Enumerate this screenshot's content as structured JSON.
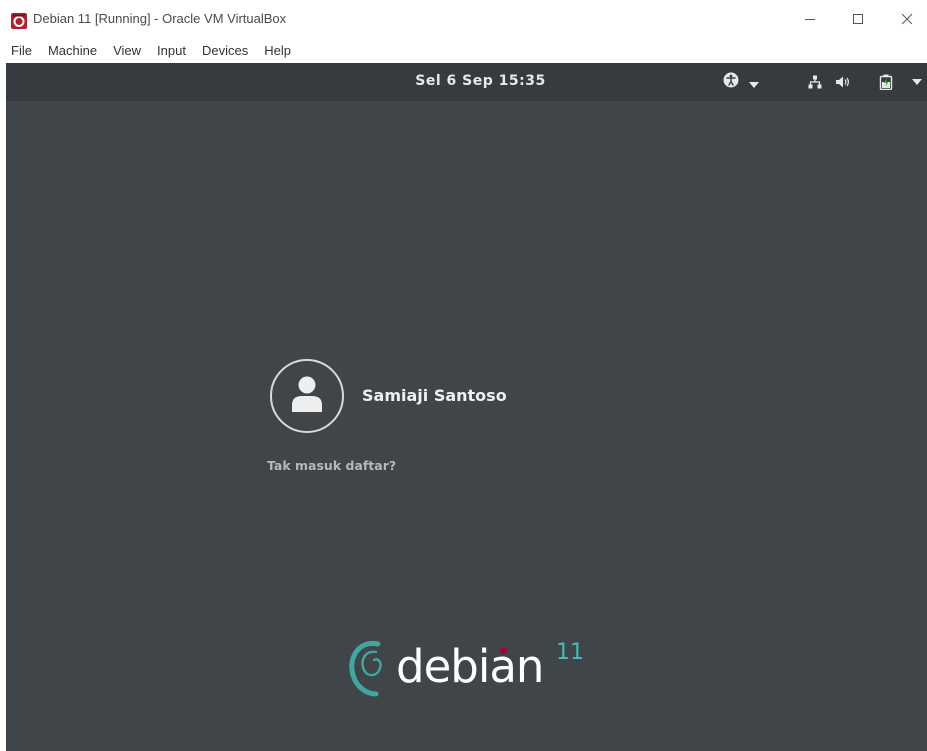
{
  "window": {
    "title": "Debian 11 [Running] - Oracle VM VirtualBox",
    "icon": "virtualbox-icon",
    "controls": [
      "minimize-icon",
      "maximize-icon",
      "close-icon"
    ]
  },
  "menubar": {
    "items": [
      "File",
      "Machine",
      "View",
      "Input",
      "Devices",
      "Help"
    ]
  },
  "gnome_topbar": {
    "clock": "Sel 6 Sep  15:35",
    "icons": [
      "accessibility-icon",
      "network-icon",
      "volume-icon",
      "battery-icon"
    ]
  },
  "login": {
    "user_name": "Samiaji Santoso",
    "not_listed": "Tak masuk daftar?"
  },
  "branding": {
    "logo_text": "debian",
    "version": "11"
  },
  "colors": {
    "desktop_bg": "#404549",
    "topbar_bg": "#373b3f",
    "debian_red": "#a80030",
    "version_teal": "#3fbfbf"
  }
}
